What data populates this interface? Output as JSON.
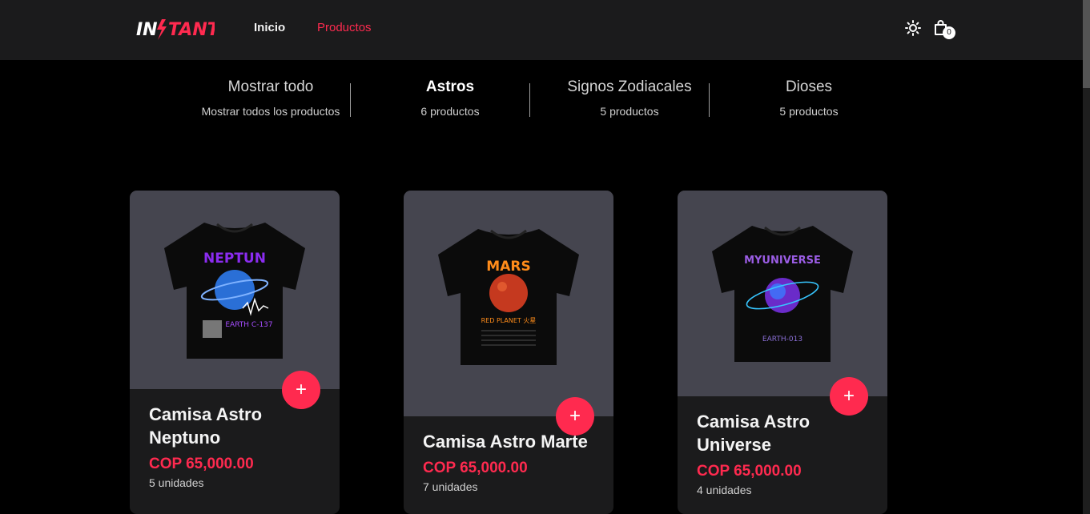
{
  "header": {
    "logo_text": "INSTANT",
    "nav": [
      {
        "label": "Inicio"
      },
      {
        "label": "Productos"
      }
    ],
    "theme_icon": "sun-icon",
    "cart_icon": "shopping-bag-icon",
    "cart_count": "0"
  },
  "categories": [
    {
      "title": "Mostrar todo",
      "subtitle": "Mostrar todos los productos"
    },
    {
      "title": "Astros",
      "subtitle": "6 productos"
    },
    {
      "title": "Signos Zodiacales",
      "subtitle": "5 productos"
    },
    {
      "title": "Dioses",
      "subtitle": "5 productos"
    }
  ],
  "products": [
    {
      "name": "Camisa Astro Neptuno",
      "price": "COP 65,000.00",
      "units": "5 unidades",
      "print_title": "NEPTUN",
      "print_footer": "EARTH C-137",
      "accent": "#8b2cf0",
      "add_label": "+"
    },
    {
      "name": "Camisa Astro Marte",
      "price": "COP 65,000.00",
      "units": "7 unidades",
      "print_title": "MARS",
      "print_footer": "RED PLANET 火星",
      "accent": "#ff8c1a",
      "add_label": "+"
    },
    {
      "name": "Camisa Astro Universe",
      "price": "COP 65,000.00",
      "units": "4 unidades",
      "print_title": "MYUNIVERSE",
      "print_footer": "EARTH-013",
      "accent": "#9b5de5",
      "add_label": "+"
    }
  ],
  "colors": {
    "brand": "#ff2a4f",
    "background": "#000000",
    "header": "#1b1b1c",
    "card": "#1b1b1c",
    "card_image": "#45454f"
  }
}
